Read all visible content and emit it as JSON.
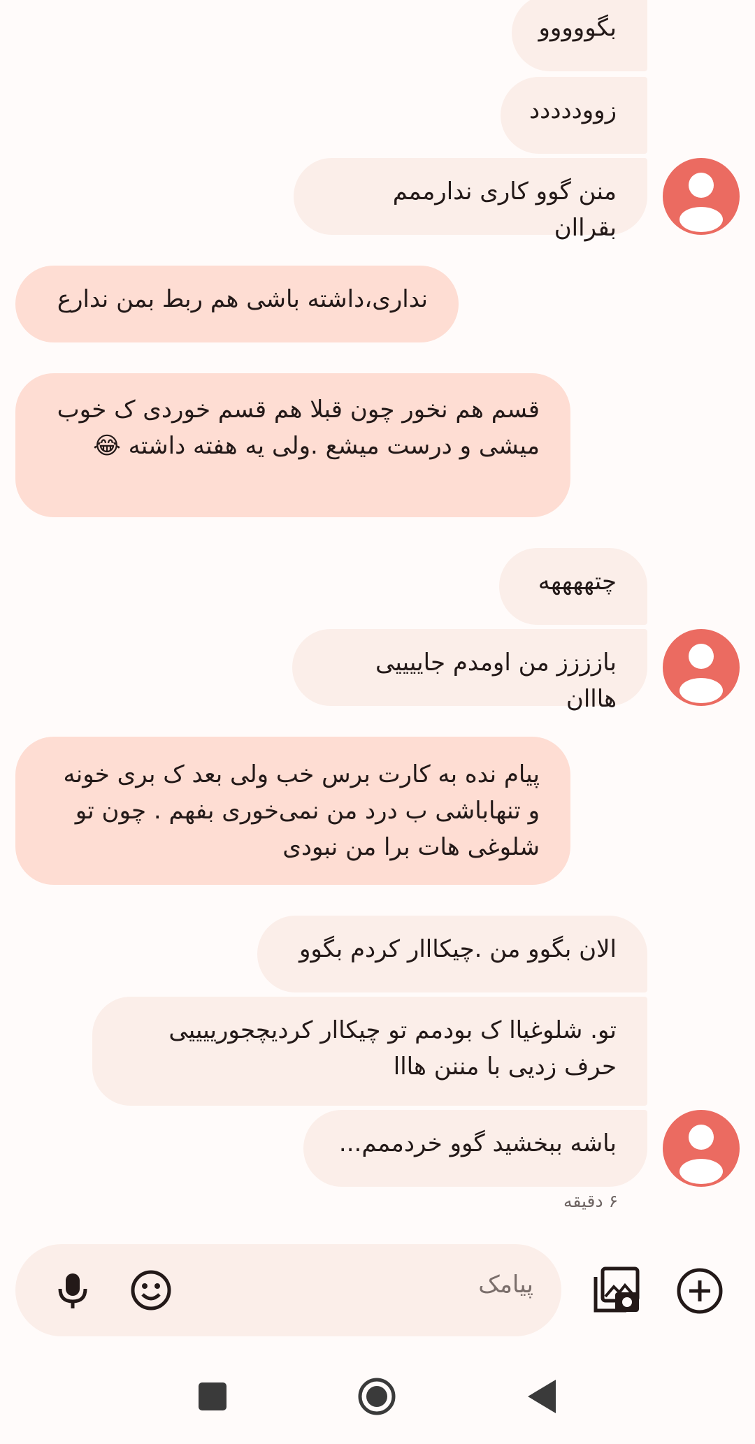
{
  "messages": [
    {
      "text": "بگووووو"
    },
    {
      "text": "زووددددد"
    },
    {
      "text": "منن گوو کاری ندارممم بقراان"
    },
    {
      "text": "نداری،داشته باشی هم ربط بمن ندارع"
    },
    {
      "text": "قسم هم نخور چون قبلا هم قسم خوردی ک خوب میشی و درست میشع .ولی یه هفته داشته 😂"
    },
    {
      "text": "چتههههه"
    },
    {
      "text": "بازززز من اومدم جاییییی هااان"
    },
    {
      "text": "پیام نده به کارت برس خب ولی بعد ک بری خونه و تنهاباشی ب درد من نمی‌خوری بفهم . چون تو شلوغی هات برا من نبودی"
    },
    {
      "text": "الان بگوو من .چیکااار کردم بگوو"
    },
    {
      "text": "تو. شلوغیاا ک بودمم تو چیکاار کردیچجورییییی حرف زدیی  با مننن هااا"
    },
    {
      "text": "باشه ببخشید گوو خردممم..."
    }
  ],
  "timestamp": "۶ دقیقه",
  "composer": {
    "placeholder": "پیامک"
  },
  "icons": {
    "avatar": "person-icon",
    "mic": "microphone-icon",
    "emoji": "emoji-icon",
    "gallery": "gallery-camera-icon",
    "add": "plus-circle-icon",
    "recents": "square-icon",
    "home": "circle-icon",
    "back": "triangle-back-icon"
  },
  "colors": {
    "background": "#FFFBFA",
    "incoming_bubble": "#FBEEE9",
    "outgoing_bubble": "#FEDDD3",
    "avatar": "#EB6B61"
  }
}
